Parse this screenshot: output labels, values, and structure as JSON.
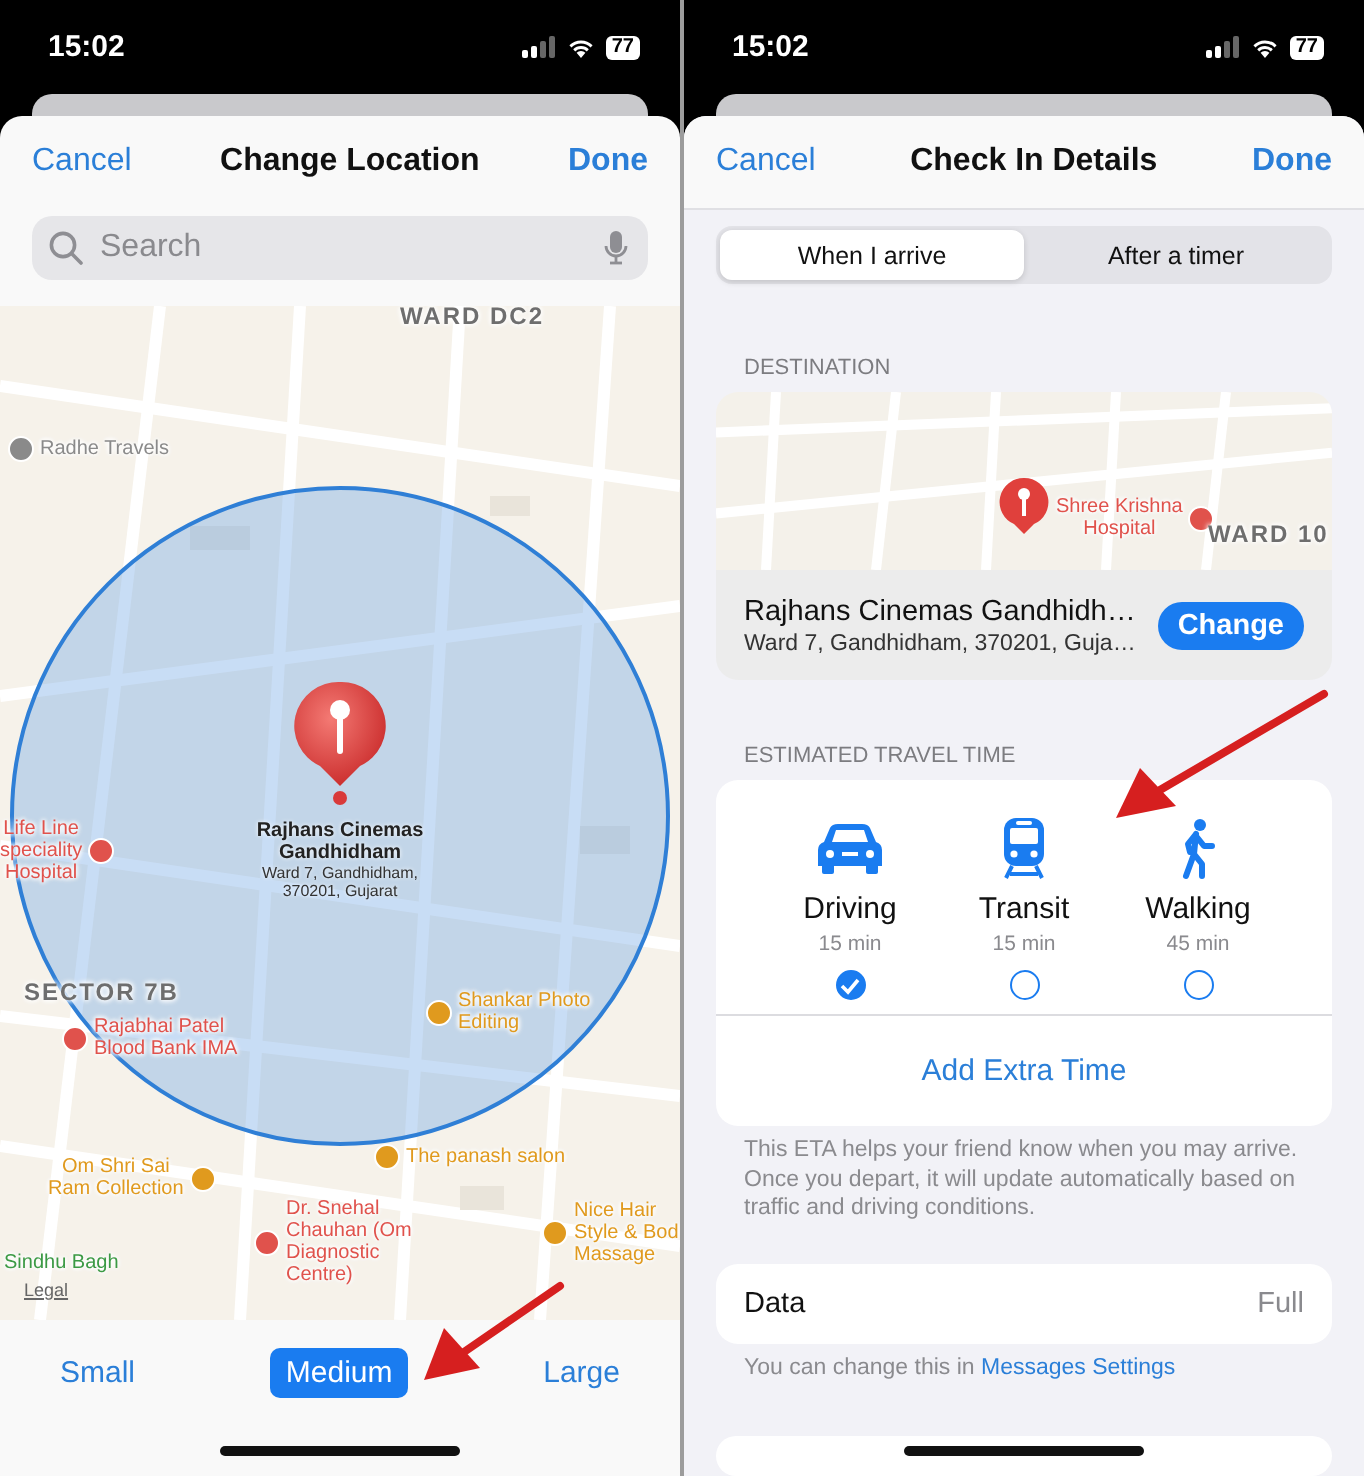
{
  "location_screen": {
    "status_bar": {
      "time": "15:02",
      "battery": "77"
    },
    "header": {
      "cancel": "Cancel",
      "title": "Change Location",
      "done": "Done"
    },
    "search": {
      "placeholder": "Search"
    },
    "map": {
      "area_labels": [
        "WARD DC2",
        "SECTOR 7B"
      ],
      "places": [
        {
          "lines": [
            "Radhe Travels"
          ],
          "color": "#8a8a8a"
        },
        {
          "lines": [
            "Life Line",
            "speciality",
            "Hospital"
          ],
          "color": "#e0524c"
        },
        {
          "lines": [
            "Rajabhai Patel",
            "Blood Bank IMA"
          ],
          "color": "#e0524c"
        },
        {
          "lines": [
            "Shankar Photo",
            "Editing"
          ],
          "color": "#e09a1e"
        },
        {
          "lines": [
            "The panash salon"
          ],
          "color": "#e09a1e"
        },
        {
          "lines": [
            "Om Shri Sai",
            "Ram Collection"
          ],
          "color": "#e09a1e"
        },
        {
          "lines": [
            "Sindhu Bagh"
          ],
          "color": "#3c9a45"
        },
        {
          "lines": [
            "Dr. Snehal",
            "Chauhan (Om",
            "Diagnostic",
            "Centre)"
          ],
          "color": "#e0524c"
        },
        {
          "lines": [
            "Nice Hair",
            "Style & Bod",
            "Massage"
          ],
          "color": "#e09a1e"
        }
      ],
      "pin": {
        "name_lines": [
          "Rajhans Cinemas",
          "Gandhidham"
        ],
        "address_lines": [
          "Ward 7, Gandhidham,",
          "370201, Gujarat"
        ]
      },
      "legal": "Legal"
    },
    "radius_options": [
      {
        "label": "Small",
        "selected": false
      },
      {
        "label": "Medium",
        "selected": true
      },
      {
        "label": "Large",
        "selected": false
      }
    ]
  },
  "check_in_screen": {
    "status_bar": {
      "time": "15:02",
      "battery": "77"
    },
    "header": {
      "cancel": "Cancel",
      "title": "Check In Details",
      "done": "Done"
    },
    "segments": [
      {
        "label": "When I arrive",
        "selected": true
      },
      {
        "label": "After a timer",
        "selected": false
      }
    ],
    "destination": {
      "section_title": "DESTINATION",
      "map": {
        "places": [
          {
            "lines": [
              "Shree Krishna",
              "Hospital"
            ],
            "color": "#e0524c"
          }
        ],
        "area_labels": [
          "WARD 10"
        ]
      },
      "name": "Rajhans Cinemas Gandhidh…",
      "address": "Ward 7, Gandhidham, 370201, Guja…",
      "button": "Change"
    },
    "travel": {
      "section_title": "ESTIMATED TRAVEL TIME",
      "modes": [
        {
          "kind": "driving",
          "name": "Driving",
          "time": "15 min",
          "selected": true
        },
        {
          "kind": "transit",
          "name": "Transit",
          "time": "15 min",
          "selected": false
        },
        {
          "kind": "walking",
          "name": "Walking",
          "time": "45 min",
          "selected": false
        }
      ],
      "add_time": "Add Extra Time",
      "footnote": "This ETA helps your friend know when you may arrive. Once you depart, it will update automatically based on traffic and driving conditions."
    },
    "data": {
      "label": "Data",
      "value": "Full",
      "note": "You can change this in ",
      "link": "Messages Settings"
    }
  }
}
